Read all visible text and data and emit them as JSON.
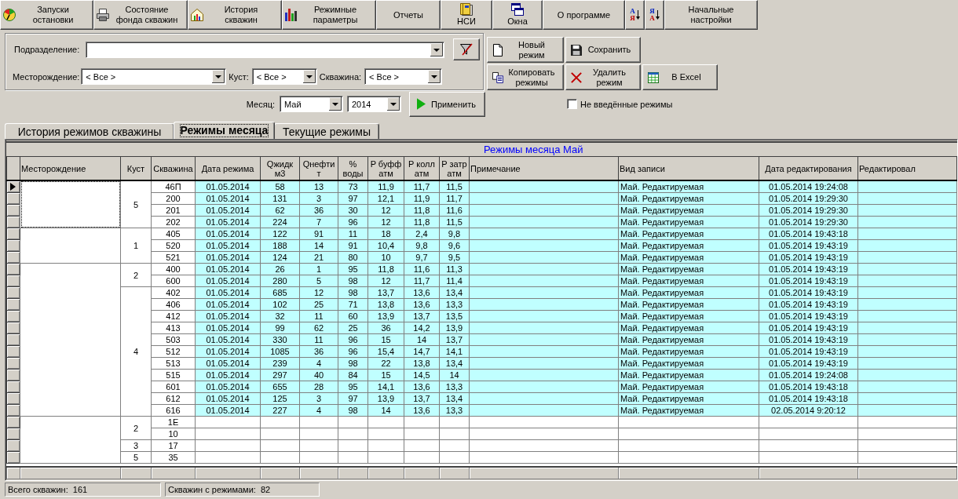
{
  "toolbar": [
    {
      "kind": "icon",
      "label": "Запуски\nостановки"
    },
    {
      "kind": "icon",
      "label": "Состояние\nфонда скважин"
    },
    {
      "kind": "icon",
      "label": "История\nскважин"
    },
    {
      "kind": "icon",
      "label": "Режимные\nпараметры"
    },
    {
      "kind": "text",
      "label": "Отчеты"
    },
    {
      "kind": "stacked",
      "label": "НСИ"
    },
    {
      "kind": "stacked",
      "label": "Окна"
    },
    {
      "kind": "text",
      "label": "О программе"
    },
    {
      "kind": "sort",
      "letters": [
        "А",
        "Я"
      ]
    },
    {
      "kind": "sort",
      "letters": [
        "Я",
        "А"
      ]
    },
    {
      "kind": "text",
      "label": "Начальные\nнастройки"
    }
  ],
  "filters": {
    "division": {
      "label": "Подразделение:"
    },
    "oilfield": {
      "label": "Месторождение:",
      "value": "< Все >"
    },
    "cluster": {
      "label": "Куст:",
      "value": "< Все >"
    },
    "well": {
      "label": "Скважина:",
      "value": "< Все >"
    }
  },
  "actions": [
    [
      "Новый\nрежим",
      "Сохранить"
    ],
    [
      "Копировать\nрежимы",
      "Удалить\nрежим",
      "В Excel"
    ]
  ],
  "period": {
    "label": "Месяц:",
    "month": "Май",
    "year": "2014",
    "apply": "Применить"
  },
  "not_entered": {
    "label": "Не введённые режимы",
    "checked": false
  },
  "tabs": [
    {
      "label": "История режимов скважины",
      "selected": false
    },
    {
      "label": "Режимы месяца",
      "selected": true
    },
    {
      "label": "Текущие режимы",
      "selected": false
    }
  ],
  "table": {
    "title": "Режимы месяца Май",
    "columns": [
      "Месторождение",
      "Куст",
      "Скважина",
      "Дата режима",
      "Qжидк\nм3",
      "Qнефти\nт",
      "%\nводы",
      "P буфф\nатм",
      "P колл\nатм",
      "P затр\nатм",
      "Примечание",
      "Вид записи",
      "Дата редактирования",
      "Редактировал"
    ],
    "groups": [
      {
        "focused": true,
        "clusters": [
          {
            "name": "5",
            "wells": [
              {
                "well": "46П",
                "kind": "filled",
                "current": true,
                "date": "01.05.2014",
                "q_liquid": "58",
                "q_oil": "13",
                "water": "73",
                "p_buffer": "11,9",
                "p_collector": "11,7",
                "p_annulus": "11,5",
                "record_type": "Май. Редактируемая",
                "edited": "01.05.2014 19:24:08"
              },
              {
                "well": "200",
                "kind": "filled",
                "current": false,
                "date": "01.05.2014",
                "q_liquid": "131",
                "q_oil": "3",
                "water": "97",
                "p_buffer": "12,1",
                "p_collector": "11,9",
                "p_annulus": "11,7",
                "record_type": "Май. Редактируемая",
                "edited": "01.05.2014 19:29:30"
              },
              {
                "well": "201",
                "kind": "filled",
                "current": false,
                "date": "01.05.2014",
                "q_liquid": "62",
                "q_oil": "36",
                "water": "30",
                "p_buffer": "12",
                "p_collector": "11,8",
                "p_annulus": "11,6",
                "record_type": "Май. Редактируемая",
                "edited": "01.05.2014 19:29:30"
              },
              {
                "well": "202",
                "kind": "filled",
                "current": false,
                "date": "01.05.2014",
                "q_liquid": "224",
                "q_oil": "7",
                "water": "96",
                "p_buffer": "12",
                "p_collector": "11,8",
                "p_annulus": "11,5",
                "record_type": "Май. Редактируемая",
                "edited": "01.05.2014 19:29:30"
              }
            ]
          }
        ]
      },
      {
        "focused": false,
        "clusters": [
          {
            "name": "1",
            "wells": [
              {
                "well": "405",
                "kind": "filled",
                "current": false,
                "date": "01.05.2014",
                "q_liquid": "122",
                "q_oil": "91",
                "water": "11",
                "p_buffer": "18",
                "p_collector": "2,4",
                "p_annulus": "9,8",
                "record_type": "Май. Редактируемая",
                "edited": "01.05.2014 19:43:18"
              },
              {
                "well": "520",
                "kind": "filled",
                "current": false,
                "date": "01.05.2014",
                "q_liquid": "188",
                "q_oil": "14",
                "water": "91",
                "p_buffer": "10,4",
                "p_collector": "9,8",
                "p_annulus": "9,6",
                "record_type": "Май. Редактируемая",
                "edited": "01.05.2014 19:43:19"
              },
              {
                "well": "521",
                "kind": "filled",
                "current": false,
                "date": "01.05.2014",
                "q_liquid": "124",
                "q_oil": "21",
                "water": "80",
                "p_buffer": "10",
                "p_collector": "9,7",
                "p_annulus": "9,5",
                "record_type": "Май. Редактируемая",
                "edited": "01.05.2014 19:43:19"
              }
            ]
          }
        ]
      },
      {
        "focused": false,
        "clusters": [
          {
            "name": "2",
            "wells": [
              {
                "well": "400",
                "kind": "filled",
                "current": false,
                "date": "01.05.2014",
                "q_liquid": "26",
                "q_oil": "1",
                "water": "95",
                "p_buffer": "11,8",
                "p_collector": "11,6",
                "p_annulus": "11,3",
                "record_type": "Май. Редактируемая",
                "edited": "01.05.2014 19:43:19"
              },
              {
                "well": "600",
                "kind": "filled",
                "current": false,
                "date": "01.05.2014",
                "q_liquid": "280",
                "q_oil": "5",
                "water": "98",
                "p_buffer": "12",
                "p_collector": "11,7",
                "p_annulus": "11,4",
                "record_type": "Май. Редактируемая",
                "edited": "01.05.2014 19:43:19"
              }
            ]
          },
          {
            "name": "4",
            "wells": [
              {
                "well": "402",
                "kind": "filled",
                "current": false,
                "date": "01.05.2014",
                "q_liquid": "685",
                "q_oil": "12",
                "water": "98",
                "p_buffer": "13,7",
                "p_collector": "13,6",
                "p_annulus": "13,4",
                "record_type": "Май. Редактируемая",
                "edited": "01.05.2014 19:43:19"
              },
              {
                "well": "406",
                "kind": "filled",
                "current": false,
                "date": "01.05.2014",
                "q_liquid": "102",
                "q_oil": "25",
                "water": "71",
                "p_buffer": "13,8",
                "p_collector": "13,6",
                "p_annulus": "13,3",
                "record_type": "Май. Редактируемая",
                "edited": "01.05.2014 19:43:19"
              },
              {
                "well": "412",
                "kind": "filled",
                "current": false,
                "date": "01.05.2014",
                "q_liquid": "32",
                "q_oil": "11",
                "water": "60",
                "p_buffer": "13,9",
                "p_collector": "13,7",
                "p_annulus": "13,5",
                "record_type": "Май. Редактируемая",
                "edited": "01.05.2014 19:43:19"
              },
              {
                "well": "413",
                "kind": "filled",
                "current": false,
                "date": "01.05.2014",
                "q_liquid": "99",
                "q_oil": "62",
                "water": "25",
                "p_buffer": "36",
                "p_collector": "14,2",
                "p_annulus": "13,9",
                "record_type": "Май. Редактируемая",
                "edited": "01.05.2014 19:43:19"
              },
              {
                "well": "503",
                "kind": "filled",
                "current": false,
                "date": "01.05.2014",
                "q_liquid": "330",
                "q_oil": "11",
                "water": "96",
                "p_buffer": "15",
                "p_collector": "14",
                "p_annulus": "13,7",
                "record_type": "Май. Редактируемая",
                "edited": "01.05.2014 19:43:19"
              },
              {
                "well": "512",
                "kind": "filled",
                "current": false,
                "date": "01.05.2014",
                "q_liquid": "1085",
                "q_oil": "36",
                "water": "96",
                "p_buffer": "15,4",
                "p_collector": "14,7",
                "p_annulus": "14,1",
                "record_type": "Май. Редактируемая",
                "edited": "01.05.2014 19:43:19"
              },
              {
                "well": "513",
                "kind": "filled",
                "current": false,
                "date": "01.05.2014",
                "q_liquid": "239",
                "q_oil": "4",
                "water": "98",
                "p_buffer": "22",
                "p_collector": "13,8",
                "p_annulus": "13,4",
                "record_type": "Май. Редактируемая",
                "edited": "01.05.2014 19:43:19"
              },
              {
                "well": "515",
                "kind": "filled",
                "current": false,
                "date": "01.05.2014",
                "q_liquid": "297",
                "q_oil": "40",
                "water": "84",
                "p_buffer": "15",
                "p_collector": "14,5",
                "p_annulus": "14",
                "record_type": "Май. Редактируемая",
                "edited": "01.05.2014 19:24:08"
              },
              {
                "well": "601",
                "kind": "filled",
                "current": false,
                "date": "01.05.2014",
                "q_liquid": "655",
                "q_oil": "28",
                "water": "95",
                "p_buffer": "14,1",
                "p_collector": "13,6",
                "p_annulus": "13,3",
                "record_type": "Май. Редактируемая",
                "edited": "01.05.2014 19:43:18"
              },
              {
                "well": "612",
                "kind": "filled",
                "current": false,
                "date": "01.05.2014",
                "q_liquid": "125",
                "q_oil": "3",
                "water": "97",
                "p_buffer": "13,9",
                "p_collector": "13,7",
                "p_annulus": "13,4",
                "record_type": "Май. Редактируемая",
                "edited": "01.05.2014 19:43:18"
              },
              {
                "well": "616",
                "kind": "filled",
                "current": false,
                "date": "01.05.2014",
                "q_liquid": "227",
                "q_oil": "4",
                "water": "98",
                "p_buffer": "14",
                "p_collector": "13,6",
                "p_annulus": "13,3",
                "record_type": "Май. Редактируемая",
                "edited": "02.05.2014 9:20:12"
              }
            ]
          }
        ]
      },
      {
        "focused": false,
        "clusters": [
          {
            "name": "2",
            "wells": [
              {
                "well": "1E",
                "kind": "empty",
                "current": false
              },
              {
                "well": "10",
                "kind": "empty",
                "current": false
              }
            ]
          },
          {
            "name": "3",
            "wells": [
              {
                "well": "17",
                "kind": "empty",
                "current": false
              }
            ]
          },
          {
            "name": "5",
            "wells": [
              {
                "well": "35",
                "kind": "empty",
                "current": false
              }
            ]
          }
        ]
      }
    ]
  },
  "status_bar": [
    "Всего скважин:  161",
    "Скважин с режимами:  82"
  ]
}
